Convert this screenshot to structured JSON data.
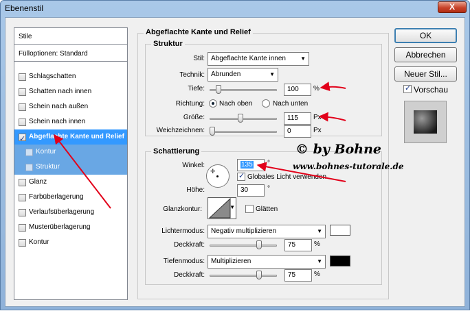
{
  "window": {
    "title": "Ebenenstil",
    "close_glyph": "X"
  },
  "left_panel": {
    "header_stile": "Stile",
    "header_fuelloptionen": "Fülloptionen: Standard",
    "items": [
      {
        "label": "Schlagschatten",
        "checked": false
      },
      {
        "label": "Schatten nach innen",
        "checked": false
      },
      {
        "label": "Schein nach außen",
        "checked": false
      },
      {
        "label": "Schein nach innen",
        "checked": false
      },
      {
        "label": "Abgeflachte Kante und Relief",
        "checked": true
      },
      {
        "label": "Kontur",
        "checked": false
      },
      {
        "label": "Struktur",
        "checked": false
      },
      {
        "label": "Glanz",
        "checked": false
      },
      {
        "label": "Farbüberlagerung",
        "checked": false
      },
      {
        "label": "Verlaufsüberlagerung",
        "checked": false
      },
      {
        "label": "Musterüberlagerung",
        "checked": false
      },
      {
        "label": "Kontur",
        "checked": false
      }
    ]
  },
  "main": {
    "section_title": "Abgeflachte Kante und Relief",
    "struktur": {
      "title": "Struktur",
      "stil_label": "Stil:",
      "stil_value": "Abgeflachte Kante innen",
      "technik_label": "Technik:",
      "technik_value": "Abrunden",
      "tiefe_label": "Tiefe:",
      "tiefe_value": "100",
      "tiefe_unit": "%",
      "tiefe_level": 0.1,
      "richtung_label": "Richtung:",
      "richtung_oben": "Nach oben",
      "richtung_unten": "Nach unten",
      "groesse_label": "Größe:",
      "groesse_value": "115",
      "groesse_unit": "Px",
      "groesse_level": 0.46,
      "weich_label": "Weichzeichnen:",
      "weich_value": "0",
      "weich_unit": "Px",
      "weich_level": 0.0
    },
    "schattierung": {
      "title": "Schattierung",
      "winkel_label": "Winkel:",
      "winkel_value": "135",
      "winkel_unit": "°",
      "globales_licht": "Globales Licht verwenden",
      "hoehe_label": "Höhe:",
      "hoehe_value": "30",
      "hoehe_unit": "°",
      "glanzkontur_label": "Glanzkontur:",
      "glaetten": "Glätten",
      "lichtermodus_label": "Lichtermodus:",
      "lichtermodus_value": "Negativ multiplizieren",
      "lichter_color": "#ffffff",
      "deckkraft1_label": "Deckkraft:",
      "deckkraft1_value": "75",
      "deckkraft1_unit": "%",
      "deckkraft1_level": 0.75,
      "tiefenmodus_label": "Tiefenmodus:",
      "tiefenmodus_value": "Multiplizieren",
      "tiefen_color": "#000000",
      "deckkraft2_label": "Deckkraft:",
      "deckkraft2_value": "75",
      "deckkraft2_unit": "%",
      "deckkraft2_level": 0.75
    }
  },
  "buttons": {
    "ok": "OK",
    "abbrechen": "Abbrechen",
    "neuer_stil": "Neuer Stil...",
    "vorschau": "Vorschau"
  },
  "watermark": {
    "line1": "© by Bohne",
    "line2": "www.bohnes-tutorale.de"
  },
  "colors": {
    "arrow": "#e2001a",
    "selection": "#3399ff"
  }
}
